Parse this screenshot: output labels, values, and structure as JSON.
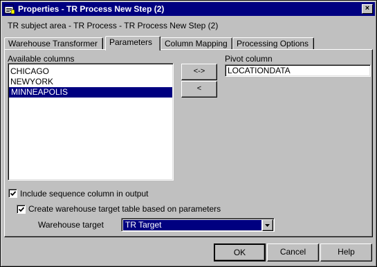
{
  "window": {
    "title": "Properties - TR Process New Step (2)",
    "close_glyph": "×"
  },
  "subject_line": "TR subject area - TR Process - TR Process New Step (2)",
  "tabs": [
    {
      "label": "Warehouse Transformer",
      "active": false
    },
    {
      "label": "Parameters",
      "active": true
    },
    {
      "label": "Column Mapping",
      "active": false
    },
    {
      "label": "Processing Options",
      "active": false
    }
  ],
  "available_columns": {
    "label": "Available columns",
    "items": [
      "CHICAGO",
      "NEWYORK",
      "MINNEAPOLIS"
    ],
    "selected": "MINNEAPOLIS"
  },
  "move_buttons": {
    "swap_label": "<->",
    "left_label": "<"
  },
  "pivot_column": {
    "label": "Pivot column",
    "value": "LOCATIONDATA"
  },
  "include_sequence": {
    "label": "Include sequence column in output",
    "checked": true
  },
  "create_target": {
    "label": "Create warehouse target table based on parameters",
    "checked": true
  },
  "warehouse_target": {
    "label": "Warehouse target",
    "value": "TR Target"
  },
  "footer": {
    "ok_label": "OK",
    "cancel_label": "Cancel",
    "help_label": "Help"
  },
  "colors": {
    "title_bar": "#000080",
    "face": "#c0c0c0",
    "selection": "#000080"
  },
  "icons": {
    "app": "properties-window-icon",
    "close": "close-icon",
    "dropdown": "chevron-down-icon",
    "check": "check-icon"
  }
}
